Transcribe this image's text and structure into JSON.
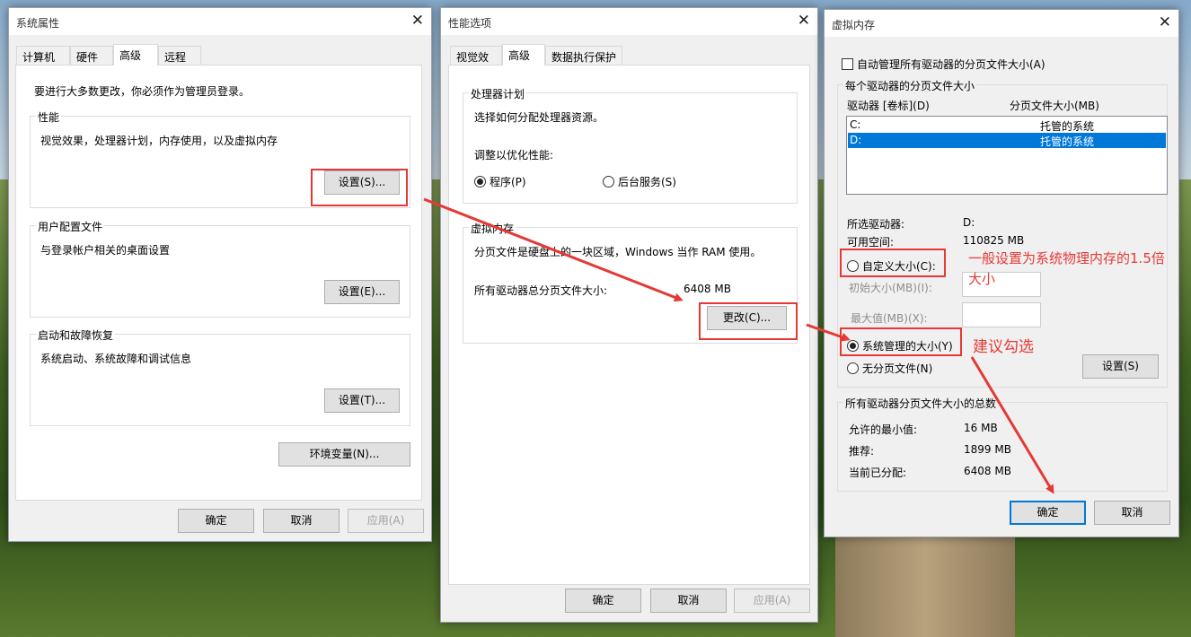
{
  "colors": {
    "annotation": "#e53935",
    "accent": "#0078d7"
  },
  "d1": {
    "title": "系统属性",
    "tabs": [
      "计算机名",
      "硬件",
      "高级",
      "远程"
    ],
    "admin_note": "要进行大多数更改，你必须作为管理员登录。",
    "perf": {
      "label": "性能",
      "desc": "视觉效果，处理器计划，内存使用，以及虚拟内存",
      "btn": "设置(S)..."
    },
    "profile": {
      "label": "用户配置文件",
      "desc": "与登录帐户相关的桌面设置",
      "btn": "设置(E)..."
    },
    "startup": {
      "label": "启动和故障恢复",
      "desc": "系统启动、系统故障和调试信息",
      "btn": "设置(T)..."
    },
    "env_btn": "环境变量(N)...",
    "ok": "确定",
    "cancel": "取消",
    "apply": "应用(A)"
  },
  "d2": {
    "title": "性能选项",
    "tabs": [
      "视觉效果",
      "高级",
      "数据执行保护"
    ],
    "sched": {
      "label": "处理器计划",
      "desc": "选择如何分配处理器资源。",
      "adjust": "调整以优化性能:",
      "opt1": "程序(P)",
      "opt2": "后台服务(S)"
    },
    "vm": {
      "label": "虚拟内存",
      "desc": "分页文件是硬盘上的一块区域，Windows 当作 RAM 使用。",
      "total_label": "所有驱动器总分页文件大小:",
      "total_value": "6408 MB",
      "change_btn": "更改(C)..."
    },
    "ok": "确定",
    "cancel": "取消",
    "apply": "应用(A)"
  },
  "d3": {
    "title": "虚拟内存",
    "auto_label": "自动管理所有驱动器的分页文件大小(A)",
    "per_drive_label": "每个驱动器的分页文件大小",
    "col_drive": "驱动器 [卷标](D)",
    "col_size": "分页文件大小(MB)",
    "drives": [
      {
        "drive": "C:",
        "size": "托管的系统"
      },
      {
        "drive": "D:",
        "size": "托管的系统"
      }
    ],
    "sel_drive_label": "所选驱动器:",
    "sel_drive_value": "D:",
    "free_label": "可用空间:",
    "free_value": "110825 MB",
    "custom": "自定义大小(C):",
    "initial": "初始大小(MB)(I):",
    "max": "最大值(MB)(X):",
    "system_managed": "系统管理的大小(Y)",
    "no_paging": "无分页文件(N)",
    "set_btn": "设置(S)",
    "totals_label": "所有驱动器分页文件大小的总数",
    "min_label": "允许的最小值:",
    "min_value": "16 MB",
    "rec_label": "推荐:",
    "rec_value": "1899 MB",
    "cur_label": "当前已分配:",
    "cur_value": "6408 MB",
    "ok": "确定",
    "cancel": "取消"
  },
  "annotations": {
    "note1_line1": "一般设置为系统物理内存的1.5倍",
    "note1_line2": "大小",
    "note2": "建议勾选"
  }
}
